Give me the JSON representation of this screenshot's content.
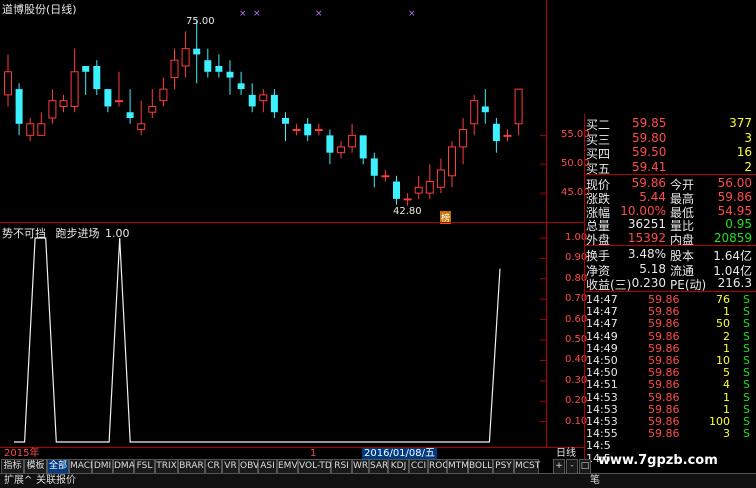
{
  "window": {
    "title": "道博股份(日线)",
    "watermark": "www.7gpzb.com"
  },
  "main_chart": {
    "high_label": "75.00",
    "low_label": "42.80",
    "marker_label": "榜",
    "y_ticks": [
      "55.00",
      "50.00",
      "45.00"
    ],
    "candles": [
      {
        "o": 62,
        "c": 66,
        "h": 69,
        "l": 60
      },
      {
        "o": 63,
        "c": 57,
        "h": 64,
        "l": 55
      },
      {
        "o": 55,
        "c": 57,
        "h": 58,
        "l": 54
      },
      {
        "o": 55,
        "c": 57,
        "h": 59,
        "l": 55
      },
      {
        "o": 58,
        "c": 61,
        "h": 63,
        "l": 57
      },
      {
        "o": 60,
        "c": 61,
        "h": 62,
        "l": 59
      },
      {
        "o": 60,
        "c": 66,
        "h": 70,
        "l": 59
      },
      {
        "o": 67,
        "c": 66,
        "h": 67,
        "l": 62
      },
      {
        "o": 67,
        "c": 63,
        "h": 68,
        "l": 62
      },
      {
        "o": 63,
        "c": 60,
        "h": 63,
        "l": 59
      },
      {
        "o": 61,
        "c": 61,
        "h": 66,
        "l": 60
      },
      {
        "o": 59,
        "c": 58,
        "h": 63,
        "l": 57
      },
      {
        "o": 56,
        "c": 57,
        "h": 61,
        "l": 55
      },
      {
        "o": 59,
        "c": 60,
        "h": 63,
        "l": 58
      },
      {
        "o": 61,
        "c": 63,
        "h": 65,
        "l": 60
      },
      {
        "o": 65,
        "c": 68,
        "h": 70,
        "l": 63
      },
      {
        "o": 67,
        "c": 70,
        "h": 73,
        "l": 65
      },
      {
        "o": 70,
        "c": 69,
        "h": 75,
        "l": 64
      },
      {
        "o": 68,
        "c": 66,
        "h": 70,
        "l": 65
      },
      {
        "o": 67,
        "c": 66,
        "h": 69,
        "l": 65
      },
      {
        "o": 66,
        "c": 65,
        "h": 68,
        "l": 62
      },
      {
        "o": 64,
        "c": 63,
        "h": 66,
        "l": 62
      },
      {
        "o": 62,
        "c": 60,
        "h": 64,
        "l": 59
      },
      {
        "o": 61,
        "c": 62,
        "h": 63,
        "l": 59
      },
      {
        "o": 62,
        "c": 59,
        "h": 63,
        "l": 58
      },
      {
        "o": 58,
        "c": 57,
        "h": 59,
        "l": 54
      },
      {
        "o": 56,
        "c": 56,
        "h": 57,
        "l": 55
      },
      {
        "o": 57,
        "c": 55,
        "h": 58,
        "l": 54
      },
      {
        "o": 56,
        "c": 56,
        "h": 57,
        "l": 55
      },
      {
        "o": 55,
        "c": 52,
        "h": 56,
        "l": 50
      },
      {
        "o": 52,
        "c": 53,
        "h": 54,
        "l": 51
      },
      {
        "o": 53,
        "c": 55,
        "h": 57,
        "l": 52
      },
      {
        "o": 55,
        "c": 51,
        "h": 55,
        "l": 50
      },
      {
        "o": 51,
        "c": 48,
        "h": 52,
        "l": 46
      },
      {
        "o": 48,
        "c": 48,
        "h": 49,
        "l": 47
      },
      {
        "o": 47,
        "c": 44,
        "h": 48,
        "l": 43
      },
      {
        "o": 44,
        "c": 44,
        "h": 45,
        "l": 42.8
      },
      {
        "o": 45,
        "c": 46,
        "h": 48,
        "l": 44
      },
      {
        "o": 45,
        "c": 47,
        "h": 50,
        "l": 44
      },
      {
        "o": 46,
        "c": 49,
        "h": 51,
        "l": 45
      },
      {
        "o": 48,
        "c": 53,
        "h": 54,
        "l": 46
      },
      {
        "o": 53,
        "c": 56,
        "h": 58,
        "l": 50
      },
      {
        "o": 57,
        "c": 61,
        "h": 62,
        "l": 55
      },
      {
        "o": 60,
        "c": 59,
        "h": 63,
        "l": 57
      },
      {
        "o": 57,
        "c": 54,
        "h": 58,
        "l": 52
      },
      {
        "o": 55,
        "c": 55,
        "h": 56,
        "l": 54
      },
      {
        "o": 57,
        "c": 63,
        "h": 63,
        "l": 55
      }
    ],
    "markers_purple_x": [
      "×",
      "×",
      "×",
      "×"
    ]
  },
  "indicator": {
    "name": "势不可挡",
    "series_label": "跑步进场",
    "series_value": "1.00",
    "y_ticks": [
      "1.00",
      "0.90",
      "0.80",
      "0.70",
      "0.60",
      "0.50",
      "0.40",
      "0.30",
      "0.20",
      "0.10"
    ],
    "values": [
      0,
      0,
      1,
      1,
      0,
      0,
      0,
      0,
      0,
      0,
      1,
      0,
      0,
      0,
      0,
      0,
      0,
      0,
      0,
      0,
      0,
      0,
      0,
      0,
      0,
      0,
      0,
      0,
      0,
      0,
      0,
      0,
      0,
      0,
      0,
      0,
      0,
      0,
      0,
      0,
      0,
      0,
      0,
      0,
      0,
      0,
      0.85
    ]
  },
  "time_axis": {
    "left": "2015年",
    "mid": "1",
    "date": "2016/01/08/五"
  },
  "quote": {
    "buy_rows": [
      {
        "label": "买二",
        "price": "59.85",
        "vol": "377"
      },
      {
        "label": "买三",
        "price": "59.80",
        "vol": "3"
      },
      {
        "label": "买四",
        "price": "59.50",
        "vol": "16"
      },
      {
        "label": "买五",
        "price": "59.41",
        "vol": "2"
      }
    ],
    "stat_rows": [
      {
        "l1": "现价",
        "v1": "59.86",
        "l2": "今开",
        "v2": "56.00",
        "c1": "red",
        "c2": "red"
      },
      {
        "l1": "涨跌",
        "v1": "5.44",
        "l2": "最高",
        "v2": "59.86",
        "c1": "red",
        "c2": "red"
      },
      {
        "l1": "涨幅",
        "v1": "10.00%",
        "l2": "最低",
        "v2": "54.95",
        "c1": "red",
        "c2": "red"
      },
      {
        "l1": "总量",
        "v1": "36251",
        "l2": "量比",
        "v2": "0.95",
        "c1": "white",
        "c2": "green"
      },
      {
        "l1": "外盘",
        "v1": "15392",
        "l2": "内盘",
        "v2": "20859",
        "c1": "red",
        "c2": "green"
      }
    ],
    "stat_rows2": [
      {
        "l1": "换手",
        "v1": "3.48%",
        "l2": "股本",
        "v2": "1.64亿",
        "c1": "white",
        "c2": "white"
      },
      {
        "l1": "净资",
        "v1": "5.18",
        "l2": "流通",
        "v2": "1.04亿",
        "c1": "white",
        "c2": "white"
      },
      {
        "l1": "收益(三)",
        "v1": "0.230",
        "l2": "PE(动)",
        "v2": "216.3",
        "c1": "white",
        "c2": "white"
      }
    ],
    "ticks": [
      {
        "t": "14:47",
        "p": "59.86",
        "v": "76",
        "s": "S"
      },
      {
        "t": "14:47",
        "p": "59.86",
        "v": "1",
        "s": "S"
      },
      {
        "t": "14:47",
        "p": "59.86",
        "v": "50",
        "s": "S"
      },
      {
        "t": "14:49",
        "p": "59.86",
        "v": "2",
        "s": "S"
      },
      {
        "t": "14:49",
        "p": "59.86",
        "v": "1",
        "s": "S"
      },
      {
        "t": "14:50",
        "p": "59.86",
        "v": "10",
        "s": "S"
      },
      {
        "t": "14:50",
        "p": "59.86",
        "v": "5",
        "s": "S"
      },
      {
        "t": "14:51",
        "p": "59.86",
        "v": "4",
        "s": "S"
      },
      {
        "t": "14:53",
        "p": "59.86",
        "v": "1",
        "s": "S"
      },
      {
        "t": "14:53",
        "p": "59.86",
        "v": "1",
        "s": "S"
      },
      {
        "t": "14:53",
        "p": "59.86",
        "v": "100",
        "s": "S"
      },
      {
        "t": "14:55",
        "p": "59.86",
        "v": "3",
        "s": "S"
      },
      {
        "t": "14:5",
        "p": "",
        "v": "",
        "s": ""
      },
      {
        "t": "14:5",
        "p": "",
        "v": "",
        "s": ""
      }
    ],
    "period_label": "日线"
  },
  "tabs": [
    "指标",
    "模板",
    "全部",
    "MACD",
    "DMI",
    "DMA",
    "FSL",
    "TRIX",
    "BRAR",
    "CR",
    "VR",
    "OBV",
    "ASI",
    "EMV",
    "VOL-TDX",
    "RSI",
    "WR",
    "SAR",
    "KDJ",
    "CCI",
    "ROC",
    "MTM",
    "BOLL",
    "PSY",
    "MCST"
  ],
  "selected_tab": "全部",
  "tab_controls": [
    "+",
    "-",
    "□"
  ],
  "bottom_bar": {
    "expand": "扩展^",
    "related": "关联报价",
    "right": "笔"
  }
}
